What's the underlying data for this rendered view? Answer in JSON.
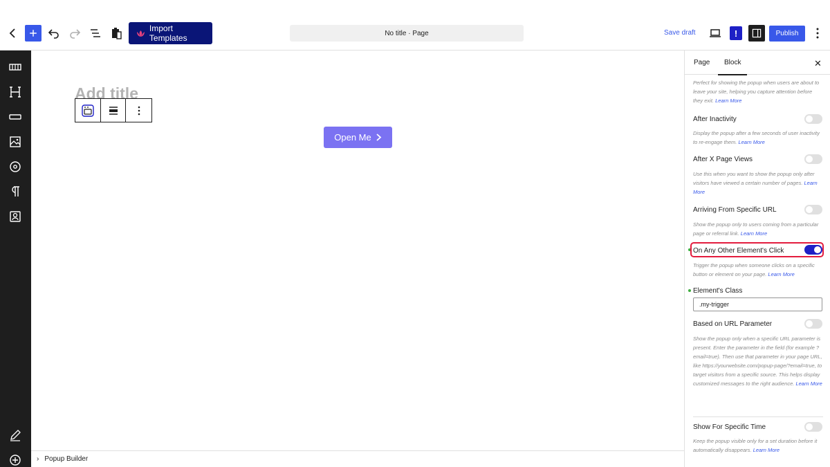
{
  "toolbar": {
    "import_label": "Import Templates",
    "doc_title": "No title · Page",
    "save_draft": "Save draft",
    "info_mark": "!",
    "publish": "Publish"
  },
  "canvas": {
    "title_placeholder": "Add title",
    "button_label": "Open Me"
  },
  "footer": {
    "breadcrumb": "Popup Builder"
  },
  "panel": {
    "tabs": [
      {
        "label": "Page"
      },
      {
        "label": "Block"
      }
    ],
    "active_tab": "Block",
    "top_desc": "Perfect for showing the popup when users are about to leave your site, helping you capture attention before they exit.",
    "learn_more": "Learn More",
    "options": [
      {
        "label": "After Inactivity",
        "desc": "Display the popup after a few seconds of user inactivity to re-engage them.",
        "enabled": false
      },
      {
        "label": "After X Page Views",
        "desc": "Use this when you want to show the popup only after visitors have viewed a certain number of pages.",
        "enabled": false
      },
      {
        "label": "Arriving From Specific URL",
        "desc": "Show the popup only to users coming from a particular page or referral link.",
        "enabled": false
      },
      {
        "label": "On Any Other Element's Click",
        "desc": "Trigger the popup when someone clicks on a specific button or element on your page.",
        "enabled": true
      },
      {
        "label": "Based on URL Parameter",
        "desc": "Show the popup only when a specific URL parameter is present. Enter the parameter in the field (for example ?email=true). Then use that parameter in your page URL, like https://yourwebsite.com/popup-page/?email=true, to target visitors from a specific source. This helps display customized messages to the right audience.",
        "enabled": false
      },
      {
        "label": "Show For Specific Time",
        "desc": "Keep the popup visible only for a set duration before it automatically disappears.",
        "enabled": false
      }
    ],
    "element_class": {
      "label": "Element's Class",
      "value": ".my-trigger"
    }
  },
  "colors": {
    "accent": "#3858e9",
    "import_bg": "#0a1577",
    "toggle_on": "#1e20c6",
    "button_bg": "#7b72f2",
    "highlight": "#e31b3d"
  }
}
